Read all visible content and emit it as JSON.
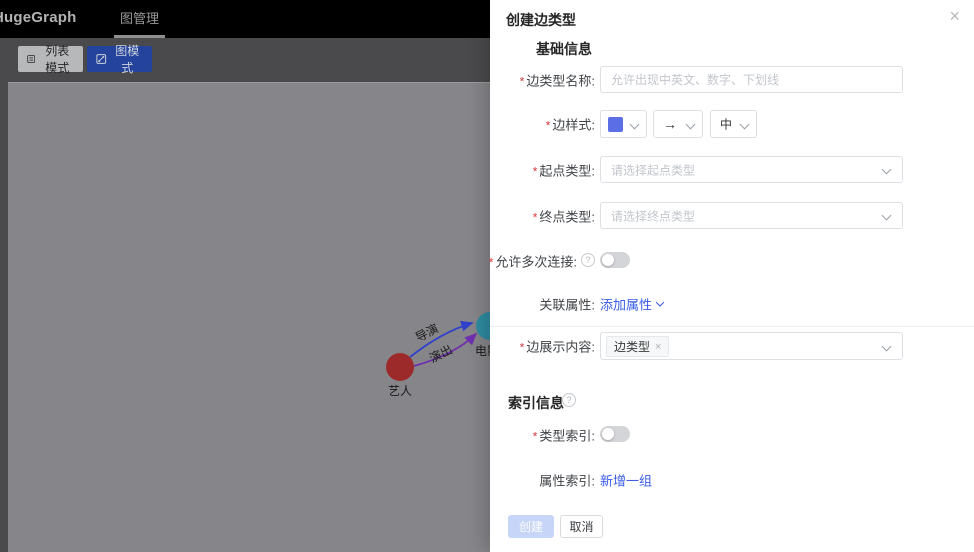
{
  "topbar": {
    "logo": "HugeGraph",
    "tab_graph_management": "图管理"
  },
  "toolbar": {
    "list_mode": "列表模式",
    "graph_mode": "图模式"
  },
  "graph": {
    "nodes": [
      {
        "label": "艺人",
        "color": "#9c2a2b"
      },
      {
        "label": "电影",
        "color": "#2e8ba1"
      }
    ],
    "edges": [
      {
        "label": "导演",
        "color": "#3140c9"
      },
      {
        "label": "演出",
        "color": "#6f2fae"
      }
    ]
  },
  "drawer": {
    "title": "创建边类型",
    "section_basic": "基础信息",
    "section_index": "索引信息",
    "required_mark": "*",
    "fields": {
      "name_label": "边类型名称:",
      "name_placeholder": "允许出现中英文、数字、下划线",
      "style_label": "边样式:",
      "style_arrow": "→",
      "style_thickness": "中",
      "style_color": "#5b6ee6",
      "source_label": "起点类型:",
      "source_placeholder": "请选择起点类型",
      "target_label": "终点类型:",
      "target_placeholder": "请选择终点类型",
      "multi_label": "允许多次连接:",
      "props_label": "关联属性:",
      "props_link": "添加属性",
      "display_label": "边展示内容:",
      "display_tag": "边类型",
      "type_index_label": "类型索引:",
      "prop_index_label": "属性索引:",
      "prop_index_link": "新增一组"
    },
    "footer": {
      "create": "创建",
      "cancel": "取消"
    }
  },
  "icons": {
    "close": "×",
    "help": "?",
    "tag_remove": "×"
  },
  "colors": {
    "link_blue": "#3a5ce8",
    "swatch_blue": "#5b6ee6",
    "create_disabled_bg": "#c7d6f8",
    "graph_mode_button": "#24439d",
    "canvas_dimmed": "#86868a",
    "topbar_bg": "#000000"
  }
}
